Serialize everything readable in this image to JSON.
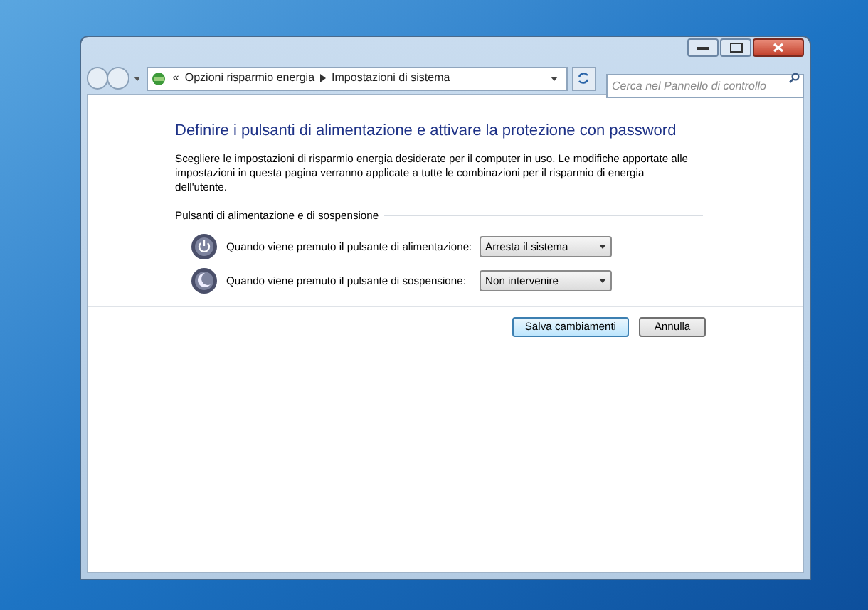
{
  "address_bar": {
    "overflow": "«",
    "crumbs": [
      "Opzioni risparmio energia",
      "Impostazioni di sistema"
    ]
  },
  "search": {
    "placeholder": "Cerca nel Pannello di controllo"
  },
  "heading": "Definire i pulsanti di alimentazione e attivare la protezione con password",
  "description": "Scegliere le impostazioni di risparmio energia desiderate per il computer in uso. Le modifiche apportate alle impostazioni in questa pagina verranno applicate a tutte le combinazioni per il risparmio di energia dell'utente.",
  "section": "Pulsanti di alimentazione e di sospensione",
  "settings": [
    {
      "kind": "power",
      "label": "Quando viene premuto il pulsante di alimentazione:",
      "value": "Arresta il sistema"
    },
    {
      "kind": "sleep",
      "label": "Quando viene premuto il pulsante di sospensione:",
      "value": "Non intervenire"
    }
  ],
  "buttons": [
    {
      "label": "Salva cambiamenti",
      "kind": "default"
    },
    {
      "label": "Annulla",
      "kind": "normal"
    }
  ]
}
